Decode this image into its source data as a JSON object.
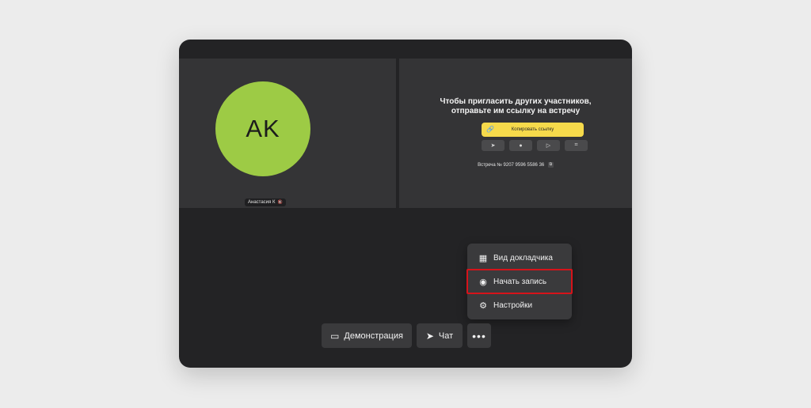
{
  "participants": [
    {
      "initials": "AK",
      "name": "Анастасия К",
      "avatar_color": "#9dcb45"
    }
  ],
  "invite": {
    "title_line1": "Чтобы пригласить других участников,",
    "title_line2": "отправьте им ссылку на встречу",
    "copy_link_label": "Копировать ссылку",
    "share_buttons": [
      "telegram-icon",
      "whatsapp-icon",
      "send-icon",
      "slack-icon"
    ],
    "meeting_id": "Встреча № 9207 9596 5586 36"
  },
  "menu": {
    "items": [
      {
        "label": "Вид докладчика",
        "icon": "presenter-view-icon"
      },
      {
        "label": "Начать запись",
        "icon": "record-icon",
        "highlighted": true
      },
      {
        "label": "Настройки",
        "icon": "gear-icon"
      }
    ]
  },
  "toolbar": {
    "demo_label": "Демонстрация",
    "chat_label": "Чат",
    "more_label": "•••"
  },
  "colors": {
    "accent_yellow": "#f6da4b",
    "highlight_red": "#d6131a"
  }
}
